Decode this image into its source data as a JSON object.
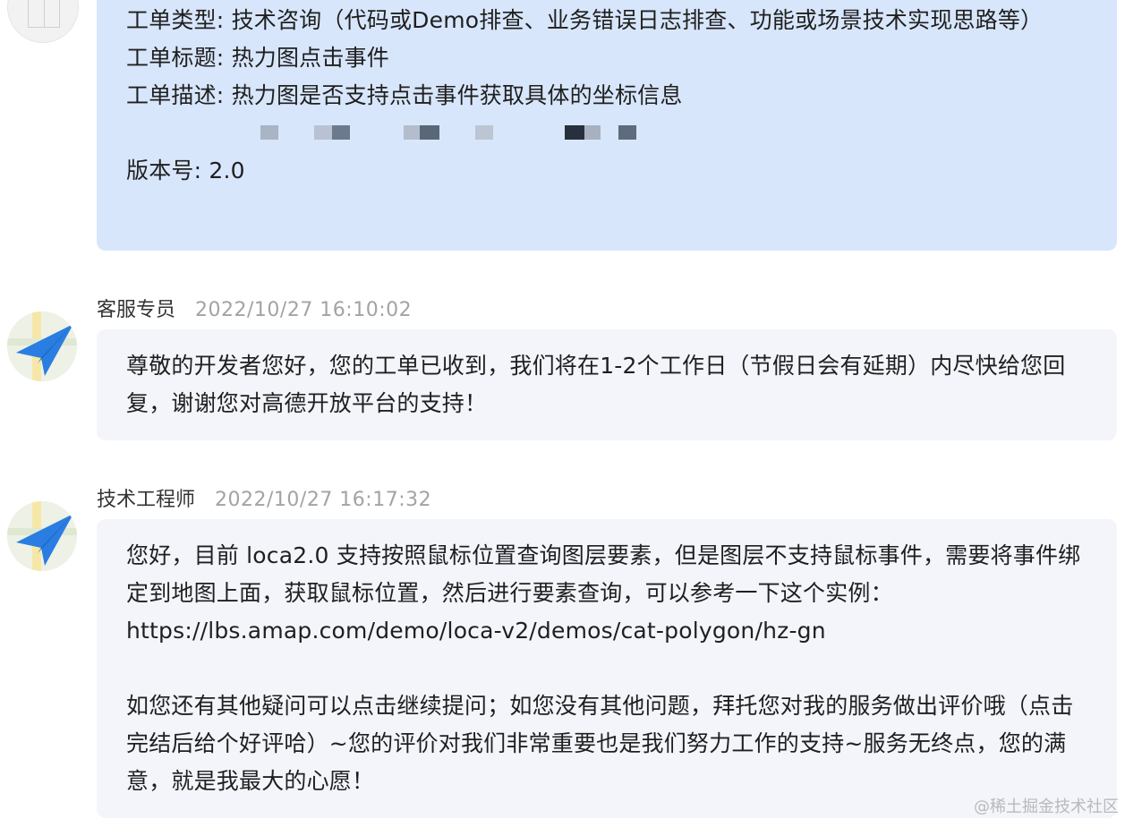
{
  "user_message": {
    "lines": [
      "工单类型: 技术咨询（代码或Demo排查、业务错误日志排查、功能或场景技术实现思路等）",
      "工单标题: 热力图点击事件",
      "工单描述: 热力图是否支持点击事件获取具体的坐标信息",
      "版本号: 2.0"
    ]
  },
  "messages": [
    {
      "name": "客服专员",
      "time": "2022/10/27 16:10:02",
      "paragraphs": [
        "尊敬的开发者您好，您的工单已收到，我们将在1-2个工作日（节假日会有延期）内尽快给您回复，谢谢您对高德开放平台的支持！"
      ]
    },
    {
      "name": "技术工程师",
      "time": "2022/10/27 16:17:32",
      "paragraphs": [
        "您好，目前 loca2.0 支持按照鼠标位置查询图层要素，但是图层不支持鼠标事件，需要将事件绑定到地图上面，获取鼠标位置，然后进行要素查询，可以参考一下这个实例：",
        "https://lbs.amap.com/demo/loca-v2/demos/cat-polygon/hz-gn",
        "如您还有其他疑问可以点击继续提问；如您没有其他问题，拜托您对我的服务做出评价哦（点击完结后给个好评哈）~您的评价对我们非常重要也是我们努力工作的支持~服务无终点，您的满意，就是我最大的心愿！"
      ]
    }
  ],
  "watermark": "@稀土掘金技术社区",
  "icons": {
    "agent_avatar": "paper-plane-icon",
    "user_avatar": "user-avatar-icon"
  },
  "colors": {
    "user_bubble": "#d8e6fb",
    "agent_bubble": "#f3f5fb",
    "plane_blue": "#2a7de1"
  }
}
